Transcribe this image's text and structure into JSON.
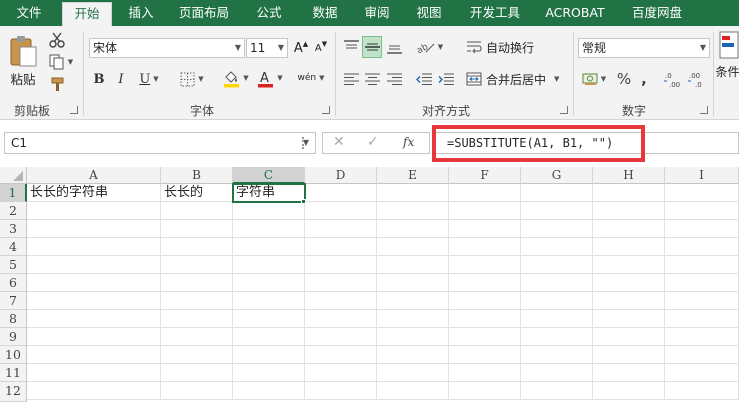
{
  "tabs": [
    "文件",
    "开始",
    "插入",
    "页面布局",
    "公式",
    "数据",
    "审阅",
    "视图",
    "开发工具",
    "ACROBAT",
    "百度网盘"
  ],
  "active_tab": "开始",
  "clipboard": {
    "paste_label": "粘贴",
    "group_label": "剪贴板"
  },
  "font": {
    "name": "宋体",
    "size": "11",
    "bold": "B",
    "italic": "I",
    "underline": "U",
    "phonetic": "wén",
    "grow": "A",
    "shrink": "A",
    "group_label": "字体"
  },
  "alignment": {
    "wrap_text": "自动换行",
    "merge_center": "合并后居中",
    "group_label": "对齐方式"
  },
  "number": {
    "format": "常规",
    "percent": "%",
    "comma": ",",
    "group_label": "数字"
  },
  "styles": {
    "conditional_label": "条件"
  },
  "formula_bar": {
    "name_box": "C1",
    "cancel": "✕",
    "enter": "✓",
    "fx": "fx",
    "formula": "=SUBSTITUTE(A1, B1, \"\")"
  },
  "columns": [
    "A",
    "B",
    "C",
    "D",
    "E",
    "F",
    "G",
    "H",
    "I"
  ],
  "selected_column": "C",
  "rows": [
    "1",
    "2",
    "3",
    "4",
    "5",
    "6",
    "7",
    "8",
    "9",
    "10",
    "11",
    "12"
  ],
  "selected_row": "1",
  "cells": {
    "A1": "长长的字符串",
    "B1": "长长的",
    "C1": "字符串"
  },
  "colors": {
    "brand": "#217346",
    "highlight": "#e8383d",
    "fill_accent": "#ffd700",
    "font_accent": "#e02020"
  }
}
